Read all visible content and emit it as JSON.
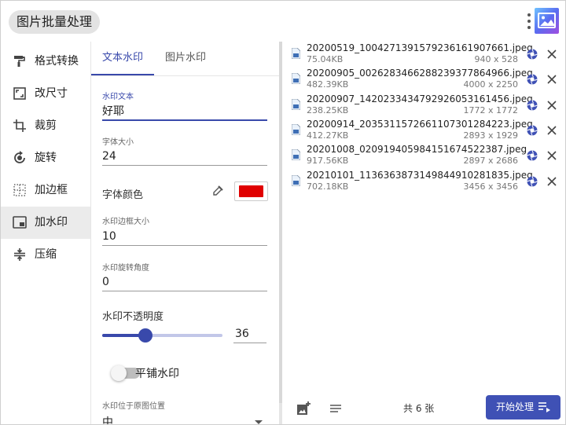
{
  "header": {
    "title": "图片批量处理"
  },
  "sidebar": {
    "items": [
      {
        "label": "格式转换",
        "icon": "format-paint-icon",
        "active": false
      },
      {
        "label": "改尺寸",
        "icon": "resize-icon",
        "active": false
      },
      {
        "label": "裁剪",
        "icon": "crop-icon",
        "active": false
      },
      {
        "label": "旋转",
        "icon": "rotate-icon",
        "active": false
      },
      {
        "label": "加边框",
        "icon": "border-icon",
        "active": false
      },
      {
        "label": "加水印",
        "icon": "watermark-icon",
        "active": true
      },
      {
        "label": "压缩",
        "icon": "compress-icon",
        "active": false
      }
    ]
  },
  "tabs": [
    {
      "label": "文本水印",
      "active": true
    },
    {
      "label": "图片水印",
      "active": false
    }
  ],
  "form": {
    "text": {
      "label": "水印文本",
      "value": "好耶"
    },
    "font_size": {
      "label": "字体大小",
      "value": "24"
    },
    "font_color": {
      "label": "字体颜色",
      "value": "#e00000"
    },
    "border_size": {
      "label": "水印边框大小",
      "value": "10"
    },
    "rotation": {
      "label": "水印旋转角度",
      "value": "0"
    },
    "opacity": {
      "label": "水印不透明度",
      "value": "36",
      "percent": 36
    },
    "tile": {
      "label": "平铺水印",
      "on": false
    },
    "position": {
      "label": "水印位于原图位置",
      "value": "中"
    }
  },
  "files": [
    {
      "name": "20200519_1004271391579236161907661.jpeg",
      "size": "75.04KB",
      "dims": "940 x 528"
    },
    {
      "name": "20200905_0026283466288239377864966.jpeg",
      "size": "482.39KB",
      "dims": "4000 x 2250"
    },
    {
      "name": "20200907_1420233434792926053161456.jpeg",
      "size": "238.25KB",
      "dims": "1772 x 1772"
    },
    {
      "name": "20200914_2035311572661107301284223.jpeg",
      "size": "412.27KB",
      "dims": "2893 x 1929"
    },
    {
      "name": "20201008_020919405984151674522387.jpeg",
      "size": "917.56KB",
      "dims": "2897 x 2686"
    },
    {
      "name": "20210101_1136363873149844910281835.jpeg",
      "size": "702.18KB",
      "dims": "3456 x 3456"
    }
  ],
  "footer": {
    "count": "共 6 张",
    "start_label": "开始处理"
  },
  "colors": {
    "accent": "#3f51b5",
    "watermark_color": "#e00000"
  }
}
